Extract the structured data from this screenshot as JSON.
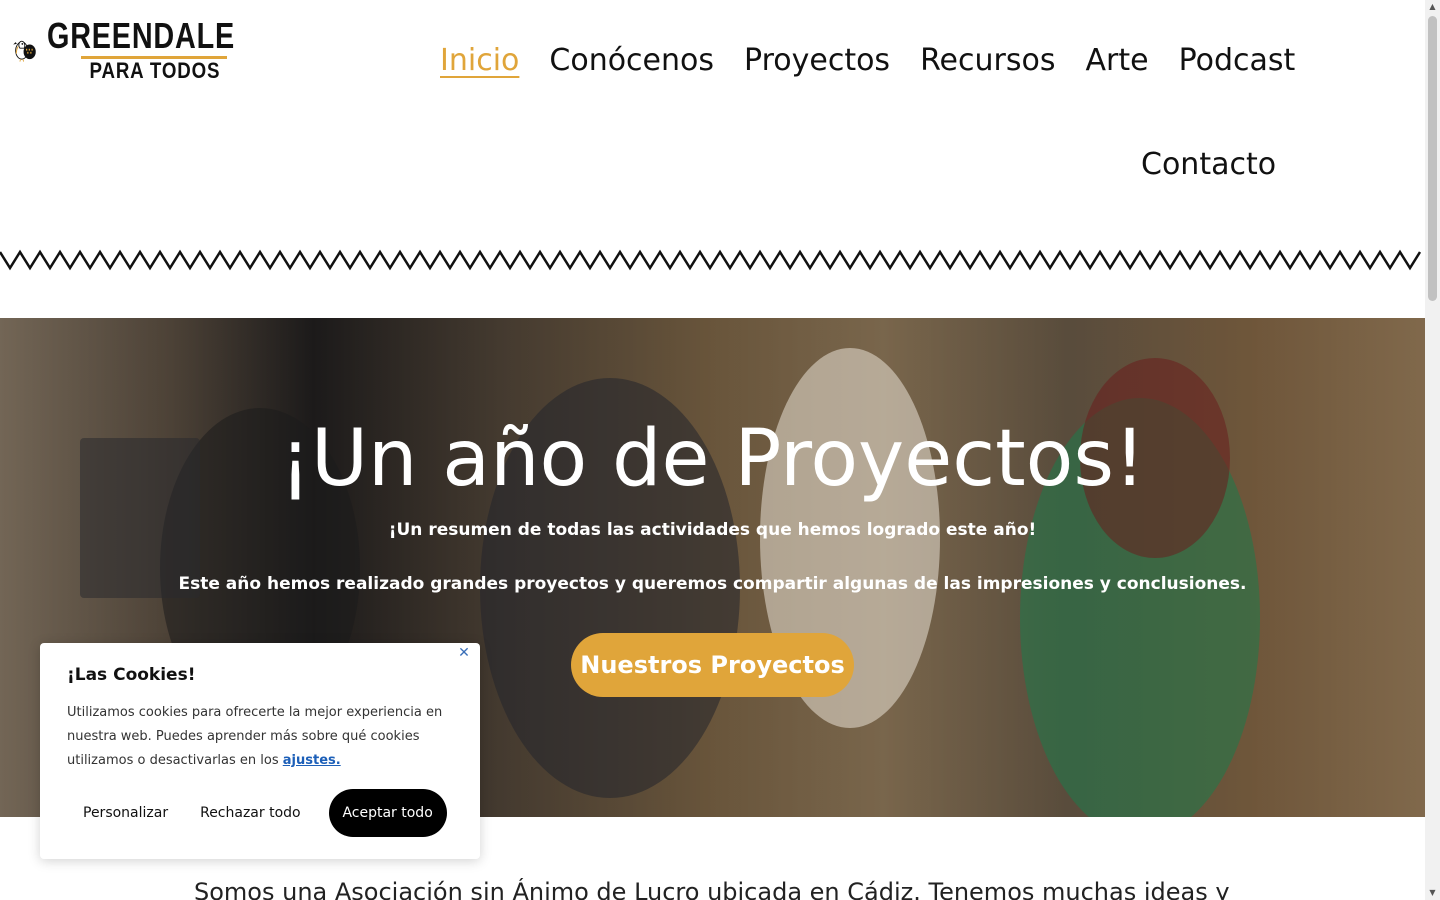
{
  "brand": {
    "title": "GREENDALE",
    "subtitle": "PARA TODOS",
    "accent": "#e0a53a"
  },
  "nav": {
    "items": [
      "Inicio",
      "Conócenos",
      "Proyectos",
      "Recursos",
      "Arte",
      "Podcast"
    ],
    "contact": "Contacto",
    "active": "Inicio"
  },
  "hero": {
    "title": "¡Un año de Proyectos!",
    "subtitle1": "¡Un resumen de todas las actividades que hemos logrado este año!",
    "subtitle2": "Este año hemos realizado grandes proyectos y queremos compartir algunas de las impresiones y conclusiones.",
    "cta": "Nuestros Proyectos"
  },
  "intro": "Somos una Asociación sin Ánimo de Lucro ubicada en Cádiz. Tenemos muchas ideas y",
  "cookie": {
    "title": "¡Las Cookies!",
    "text": "Utilizamos cookies para ofrecerte la mejor experiencia en nuestra web. Puedes aprender más sobre qué cookies utilizamos o desactivarlas en los",
    "link": "ajustes.",
    "buttons": {
      "customize": "Personalizar",
      "reject": "Rechazar todo",
      "accept": "Aceptar todo"
    },
    "close_icon": "close-icon"
  }
}
